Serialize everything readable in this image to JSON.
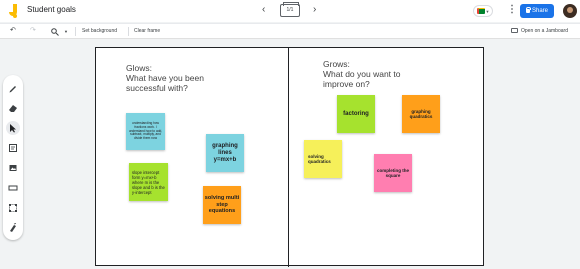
{
  "app": {
    "title": "Student goals"
  },
  "frames": {
    "counter": "1/1"
  },
  "header": {
    "share_label": "Share"
  },
  "toolbar": {
    "background_label": "Set background",
    "clear_label": "Clear frame",
    "open_label": "Open on a Jamboard"
  },
  "board": {
    "left_heading": "Glows:\nWhat have you been\nsuccessful with?",
    "right_heading": "Grows:\nWhat do you want to\nimprove on?",
    "notes": [
      {
        "text": "understanding how fractions work. I understand how to add, subtract, multiply, and divide them now",
        "color": "#7dd3e0"
      },
      {
        "text": "graphing lines y=mx+b",
        "color": "#7dd3e0"
      },
      {
        "text": "slope intercept form y=mx+b where m is the slope and b is the y-intercept",
        "color": "#a6e22e"
      },
      {
        "text": "solving multi step equations",
        "color": "#ff9f1a"
      },
      {
        "text": "factoring",
        "color": "#a6e22e"
      },
      {
        "text": "graphing quadratics",
        "color": "#ff9f1a"
      },
      {
        "text": "solving quadratics",
        "color": "#f6f05a"
      },
      {
        "text": "completing the square",
        "color": "#ff7eb0"
      }
    ]
  },
  "colors": {
    "accent": "#1a73e8",
    "logo": "#fbbc04"
  }
}
